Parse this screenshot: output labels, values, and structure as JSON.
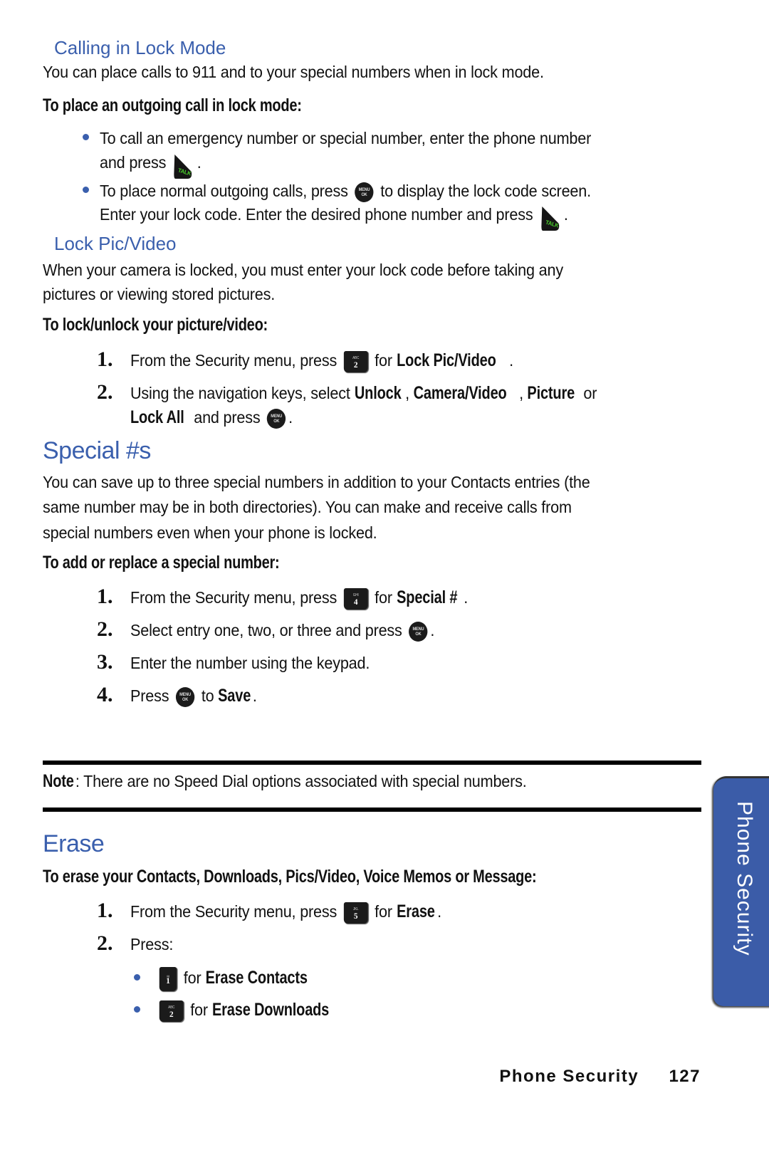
{
  "calling_lock_mode": {
    "heading": "Calling in Lock Mode",
    "intro": "You can place calls to 911 and to your special numbers when in lock mode.",
    "subheading": "To place an outgoing call in lock mode:",
    "bullets": [
      {
        "line1": "To call an emergency number or special number, enter the phone number",
        "line2_pre": "and press",
        "key": "TALK",
        "line2_post": "."
      },
      {
        "line1_pre": "To place normal outgoing calls, press",
        "key1": "MENU OK",
        "line1_post": "to display the lock code screen.",
        "line2_pre": "Enter your lock code. Enter the desired phone number and press",
        "key2": "TALK",
        "line2_post": "."
      }
    ]
  },
  "lock_pic_video": {
    "heading": "Lock Pic/Video",
    "intro_line1": "When your camera is locked, you must enter your lock code before taking any",
    "intro_line2": "pictures or viewing stored pictures.",
    "subheading": "To lock/unlock your picture/video:",
    "steps": [
      {
        "num": "1.",
        "pre": "From the Security menu, press",
        "key_num": "2",
        "key_letters": "ABC",
        "mid": "for",
        "bold": "Lock Pic/Video",
        "post": "."
      },
      {
        "num": "2.",
        "pre": "Using the navigation keys, select",
        "bold1": "Unlock",
        "sep1": ",",
        "bold2": "Camera/Video",
        "sep2": ",",
        "bold3": "Picture",
        "or": "or",
        "bold4": "Lock All",
        "post_pre": "and press",
        "key": "MENU OK",
        "post": "."
      }
    ]
  },
  "special_numbers": {
    "heading": "Special #s",
    "paragraph": [
      "You can save up to three special numbers in addition to your Contacts entries (the",
      "same number may be in both directories). You can make and receive calls from",
      "special numbers even when your phone is locked."
    ],
    "subheading": "To add or replace a special number:",
    "steps": [
      {
        "num": "1.",
        "pre": "From the Security menu, press",
        "key_num": "4",
        "key_letters": "GHI",
        "mid": "for",
        "bold": "Special #",
        "post": "."
      },
      {
        "num": "2.",
        "pre": "Select entry one, two, or three and press",
        "key": "MENU OK",
        "post": "."
      },
      {
        "num": "3.",
        "text": "Enter the number using the keypad."
      },
      {
        "num": "4.",
        "pre": "Press",
        "key": "MENU OK",
        "mid": "to",
        "bold": "Save",
        "post": "."
      }
    ],
    "note_label": "Note",
    "note_text": ": There are no Speed Dial options associated with special numbers."
  },
  "erase": {
    "heading": "Erase",
    "subheading": "To erase your Contacts, Downloads, Pics/Video, Voice Memos or Message:",
    "steps": [
      {
        "num": "1.",
        "pre": "From the Security menu, press",
        "key_num": "5",
        "key_letters": "JKL",
        "mid": "for",
        "bold": "Erase",
        "post": "."
      },
      {
        "num": "2.",
        "text": "Press:"
      }
    ],
    "sub_bullets": [
      {
        "key_num": "1",
        "key_letters": "✉",
        "mid": "for",
        "bold": "Erase Contacts"
      },
      {
        "key_num": "2",
        "key_letters": "ABC",
        "mid": "for",
        "bold": "Erase Downloads"
      }
    ]
  },
  "side_tab": {
    "label": "Phone Security",
    "color": "#3b5ca8"
  },
  "footer": {
    "section": "Phone Security",
    "page": "127"
  },
  "colors": {
    "heading_blue": "#3a5fad",
    "text": "#111111"
  }
}
